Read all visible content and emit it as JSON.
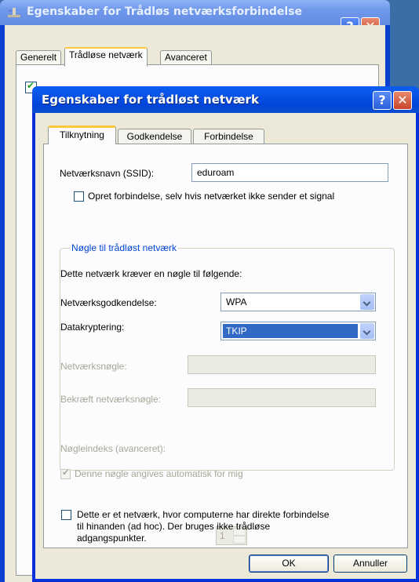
{
  "back_window": {
    "title": "Egenskaber for Trådløs netværksforbindelse",
    "tabs": [
      "Generelt",
      "Trådløse netværk",
      "Avanceret"
    ],
    "active_tab": "Trådløse netværk"
  },
  "dialog": {
    "title": "Egenskaber for trådløst netværk",
    "tabs": [
      "Tilknytning",
      "Godkendelse",
      "Forbindelse"
    ],
    "active_tab": "Tilknytning",
    "ssid_label": "Netværksnavn (SSID):",
    "ssid_value": "eduroam",
    "connect_even_if_not_broadcasting": {
      "label": "Opret forbindelse, selv hvis netværket ikke sender et signal",
      "checked": false
    },
    "key_group": {
      "title": "Nøgle til trådløst netværk",
      "intro": "Dette netværk kræver en nøgle til følgende:",
      "auth_label": "Netværksgodkendelse:",
      "auth_value": "WPA",
      "encryption_label": "Datakryptering:",
      "encryption_value": "TKIP",
      "network_key_label": "Netværksnøgle:",
      "confirm_key_label": "Bekræft netværksnøgle:",
      "key_index_label": "Nøgleindeks (avanceret):",
      "key_index_value": "1",
      "auto_key": {
        "label": "Denne nøgle angives automatisk for mig",
        "checked": true
      }
    },
    "adhoc": {
      "line1": "Dette er et netværk, hvor computerne har direkte forbindelse",
      "line2": "til hinanden (ad hoc). Der bruges ikke trådløse",
      "line3": "adgangspunkter.",
      "checked": false
    },
    "ok_label": "OK",
    "cancel_label": "Annuller",
    "help_glyph": "?",
    "close_glyph": "✕"
  },
  "colors": {
    "titlebar_active": "#0a54e8",
    "titlebar_inactive": "#7a9ee8",
    "dialog_face": "#ece9d8",
    "group_title": "#0046d5",
    "selection": "#316ac5"
  }
}
